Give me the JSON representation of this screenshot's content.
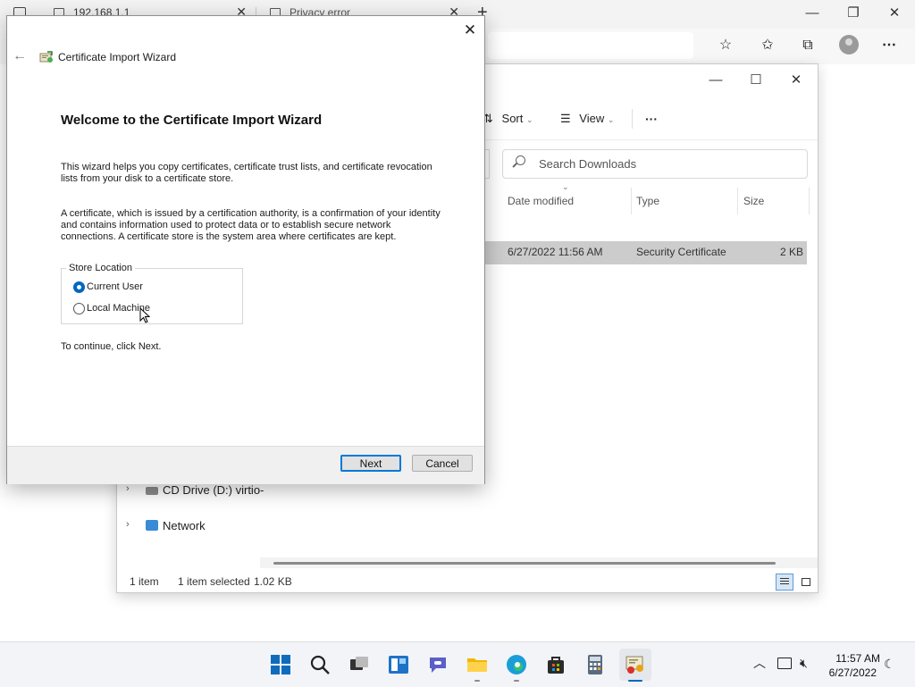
{
  "browser": {
    "tabs": [
      {
        "label": "192.168.1.1"
      },
      {
        "label": "Privacy error"
      }
    ],
    "new_tab_icon": "plus-icon",
    "toolbar_icons": [
      "add-favorite-icon",
      "favorites-icon",
      "collections-icon",
      "profile-icon",
      "more-icon"
    ]
  },
  "explorer": {
    "toolbar": {
      "sort_label": "Sort",
      "view_label": "View",
      "more_label": "···"
    },
    "search_placeholder": "Search Downloads",
    "columns": {
      "date": "Date modified",
      "type": "Type",
      "size": "Size"
    },
    "file": {
      "date": "6/27/2022 11:56 AM",
      "type": "Security Certificate",
      "size": "2 KB"
    },
    "nav": [
      {
        "label": "CD Drive (D:) virtio-",
        "icon": "cd-drive-icon"
      },
      {
        "label": "Network",
        "icon": "network-icon"
      }
    ],
    "status": {
      "count": "1 item",
      "selected": "1 item selected",
      "size": "1.02 KB"
    }
  },
  "wizard": {
    "title": "Certificate Import Wizard",
    "heading": "Welcome to the Certificate Import Wizard",
    "para1_line1": "This wizard helps you copy certificates, certificate trust lists, and certificate revocation",
    "para1_line2": "lists from your disk to a certificate store.",
    "para2_line1": "A certificate, which is issued by a certification authority, is a confirmation of your identity",
    "para2_line2": "and contains information used to protect data or to establish secure network",
    "para2_line3": "connections. A certificate store is the system area where certificates are kept.",
    "store_location_label": "Store Location",
    "options": [
      {
        "label": "Current User",
        "selected": true
      },
      {
        "label": "Local Machine",
        "selected": false
      }
    ],
    "continue_text": "To continue, click Next.",
    "next_label": "Next",
    "cancel_label": "Cancel"
  },
  "taskbar": {
    "apps": [
      "start-icon",
      "search-icon",
      "task-view-icon",
      "widgets-icon",
      "chat-icon",
      "file-explorer-icon",
      "edge-icon",
      "store-icon",
      "calculator-icon",
      "certificate-icon"
    ],
    "time": "11:57 AM",
    "date": "6/27/2022"
  },
  "colors": {
    "accent": "#0067c0",
    "selection": "#cccccc",
    "taskbar": "#f2f4f8"
  }
}
